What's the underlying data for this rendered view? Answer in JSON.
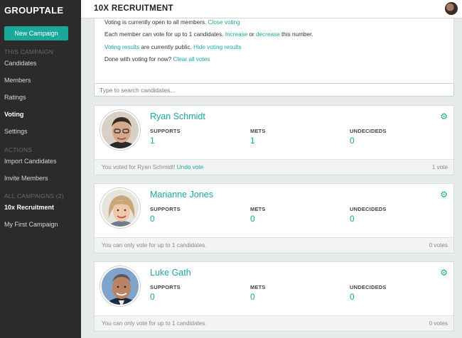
{
  "app": {
    "brand": "GROUPTALE",
    "new_campaign_label": "New Campaign"
  },
  "sidebar": {
    "this_campaign_title": "THIS CAMPAIGN",
    "campaign_items": [
      {
        "label": "Candidates"
      },
      {
        "label": "Members"
      },
      {
        "label": "Ratings"
      },
      {
        "label": "Voting"
      },
      {
        "label": "Settings"
      }
    ],
    "actions_title": "ACTIONS",
    "action_items": [
      {
        "label": "Import Candidates"
      },
      {
        "label": "Invite Members"
      }
    ],
    "all_campaigns_title": "ALL CAMPAIGNS (2)",
    "campaigns": [
      {
        "label": "10x Recruitment"
      },
      {
        "label": "My First Campaign"
      }
    ]
  },
  "header": {
    "title": "10X RECRUITMENT"
  },
  "voting_info": {
    "open_text": "Voting is currently open to all members.",
    "close_link": "Close voting",
    "limit_text_1": "Each member can vote for up to 1 candidates.",
    "increase_link": "Increase",
    "or_text": "or",
    "decrease_link": "decrease",
    "limit_text_2": "this number.",
    "results_link": "Voting results",
    "results_text": "are currently public.",
    "hide_link": "Hide voting results",
    "done_text": "Done with voting for now?",
    "clear_link": "Clear all votes"
  },
  "search": {
    "placeholder": "Type to search candidates..."
  },
  "stat_labels": {
    "supports": "SUPPORTS",
    "mets": "METS",
    "undecideds": "UNDECIDEDS"
  },
  "candidates": [
    {
      "name": "Ryan Schmidt",
      "supports": "1",
      "mets": "1",
      "undecideds": "0",
      "footer_text": "You voted for Ryan Schmidt!",
      "footer_link": "Undo vote",
      "votes": "1 vote"
    },
    {
      "name": "Marianne Jones",
      "supports": "0",
      "mets": "0",
      "undecideds": "0",
      "footer_text": "You can only vote for up to 1 candidates.",
      "footer_link": "",
      "votes": "0 votes"
    },
    {
      "name": "Luke Gath",
      "supports": "0",
      "mets": "0",
      "undecideds": "0",
      "footer_text": "You can only vote for up to 1 candidates.",
      "footer_link": "",
      "votes": "0 votes"
    }
  ],
  "colors": {
    "accent": "#1aa89b",
    "sidebar": "#2b2b2b"
  }
}
